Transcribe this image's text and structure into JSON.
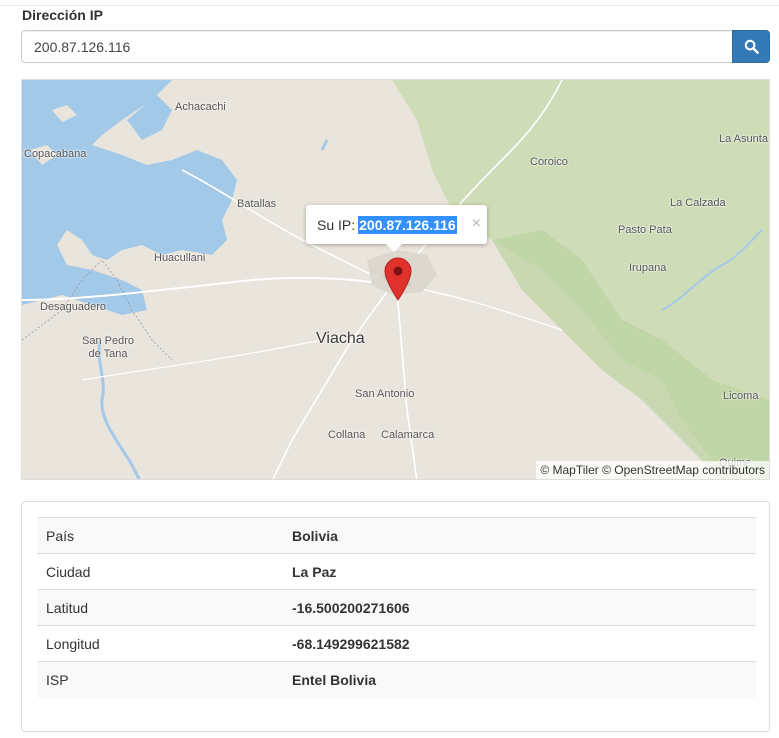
{
  "search": {
    "label": "Dirección IP",
    "value": "200.87.126.116",
    "button_icon": "search-icon"
  },
  "map": {
    "places": [
      {
        "id": "achacachi",
        "label": "Achacachi"
      },
      {
        "id": "copacabana",
        "label": "Copacabana"
      },
      {
        "id": "batallas",
        "label": "Batallas"
      },
      {
        "id": "huacullani",
        "label": "Huacullani"
      },
      {
        "id": "desaguadero",
        "label": "Desaguadero"
      },
      {
        "id": "san-pedro",
        "label": "San Pedro\nde Tana"
      },
      {
        "id": "viacha",
        "label": "Viacha"
      },
      {
        "id": "san-antonio",
        "label": "San Antonio"
      },
      {
        "id": "collana",
        "label": "Collana"
      },
      {
        "id": "calamarca",
        "label": "Calamarca"
      },
      {
        "id": "coroico",
        "label": "Coroico"
      },
      {
        "id": "la-asunta",
        "label": "La Asunta"
      },
      {
        "id": "la-calzada",
        "label": "La Calzada"
      },
      {
        "id": "pasto-pata",
        "label": "Pasto Pata"
      },
      {
        "id": "irupana",
        "label": "Irupana"
      },
      {
        "id": "licoma",
        "label": "Licoma"
      },
      {
        "id": "quime",
        "label": "Quime"
      }
    ],
    "popup": {
      "prefix": "Su IP:",
      "ip": "200.87.126.116",
      "close": "×"
    },
    "attribution": "© MapTiler © OpenStreetMap contributors",
    "water_color": "#a3c9e8",
    "forest_color": "#c9dbb0",
    "land_color": "#e9e5dc",
    "marker_color": "#e0322c"
  },
  "info": {
    "rows": [
      {
        "key": "País",
        "value": "Bolivia"
      },
      {
        "key": "Ciudad",
        "value": "La Paz"
      },
      {
        "key": "Latitud",
        "value": "-16.500200271606"
      },
      {
        "key": "Longitud",
        "value": "-68.149299621582"
      },
      {
        "key": "ISP",
        "value": "Entel Bolivia"
      }
    ]
  }
}
